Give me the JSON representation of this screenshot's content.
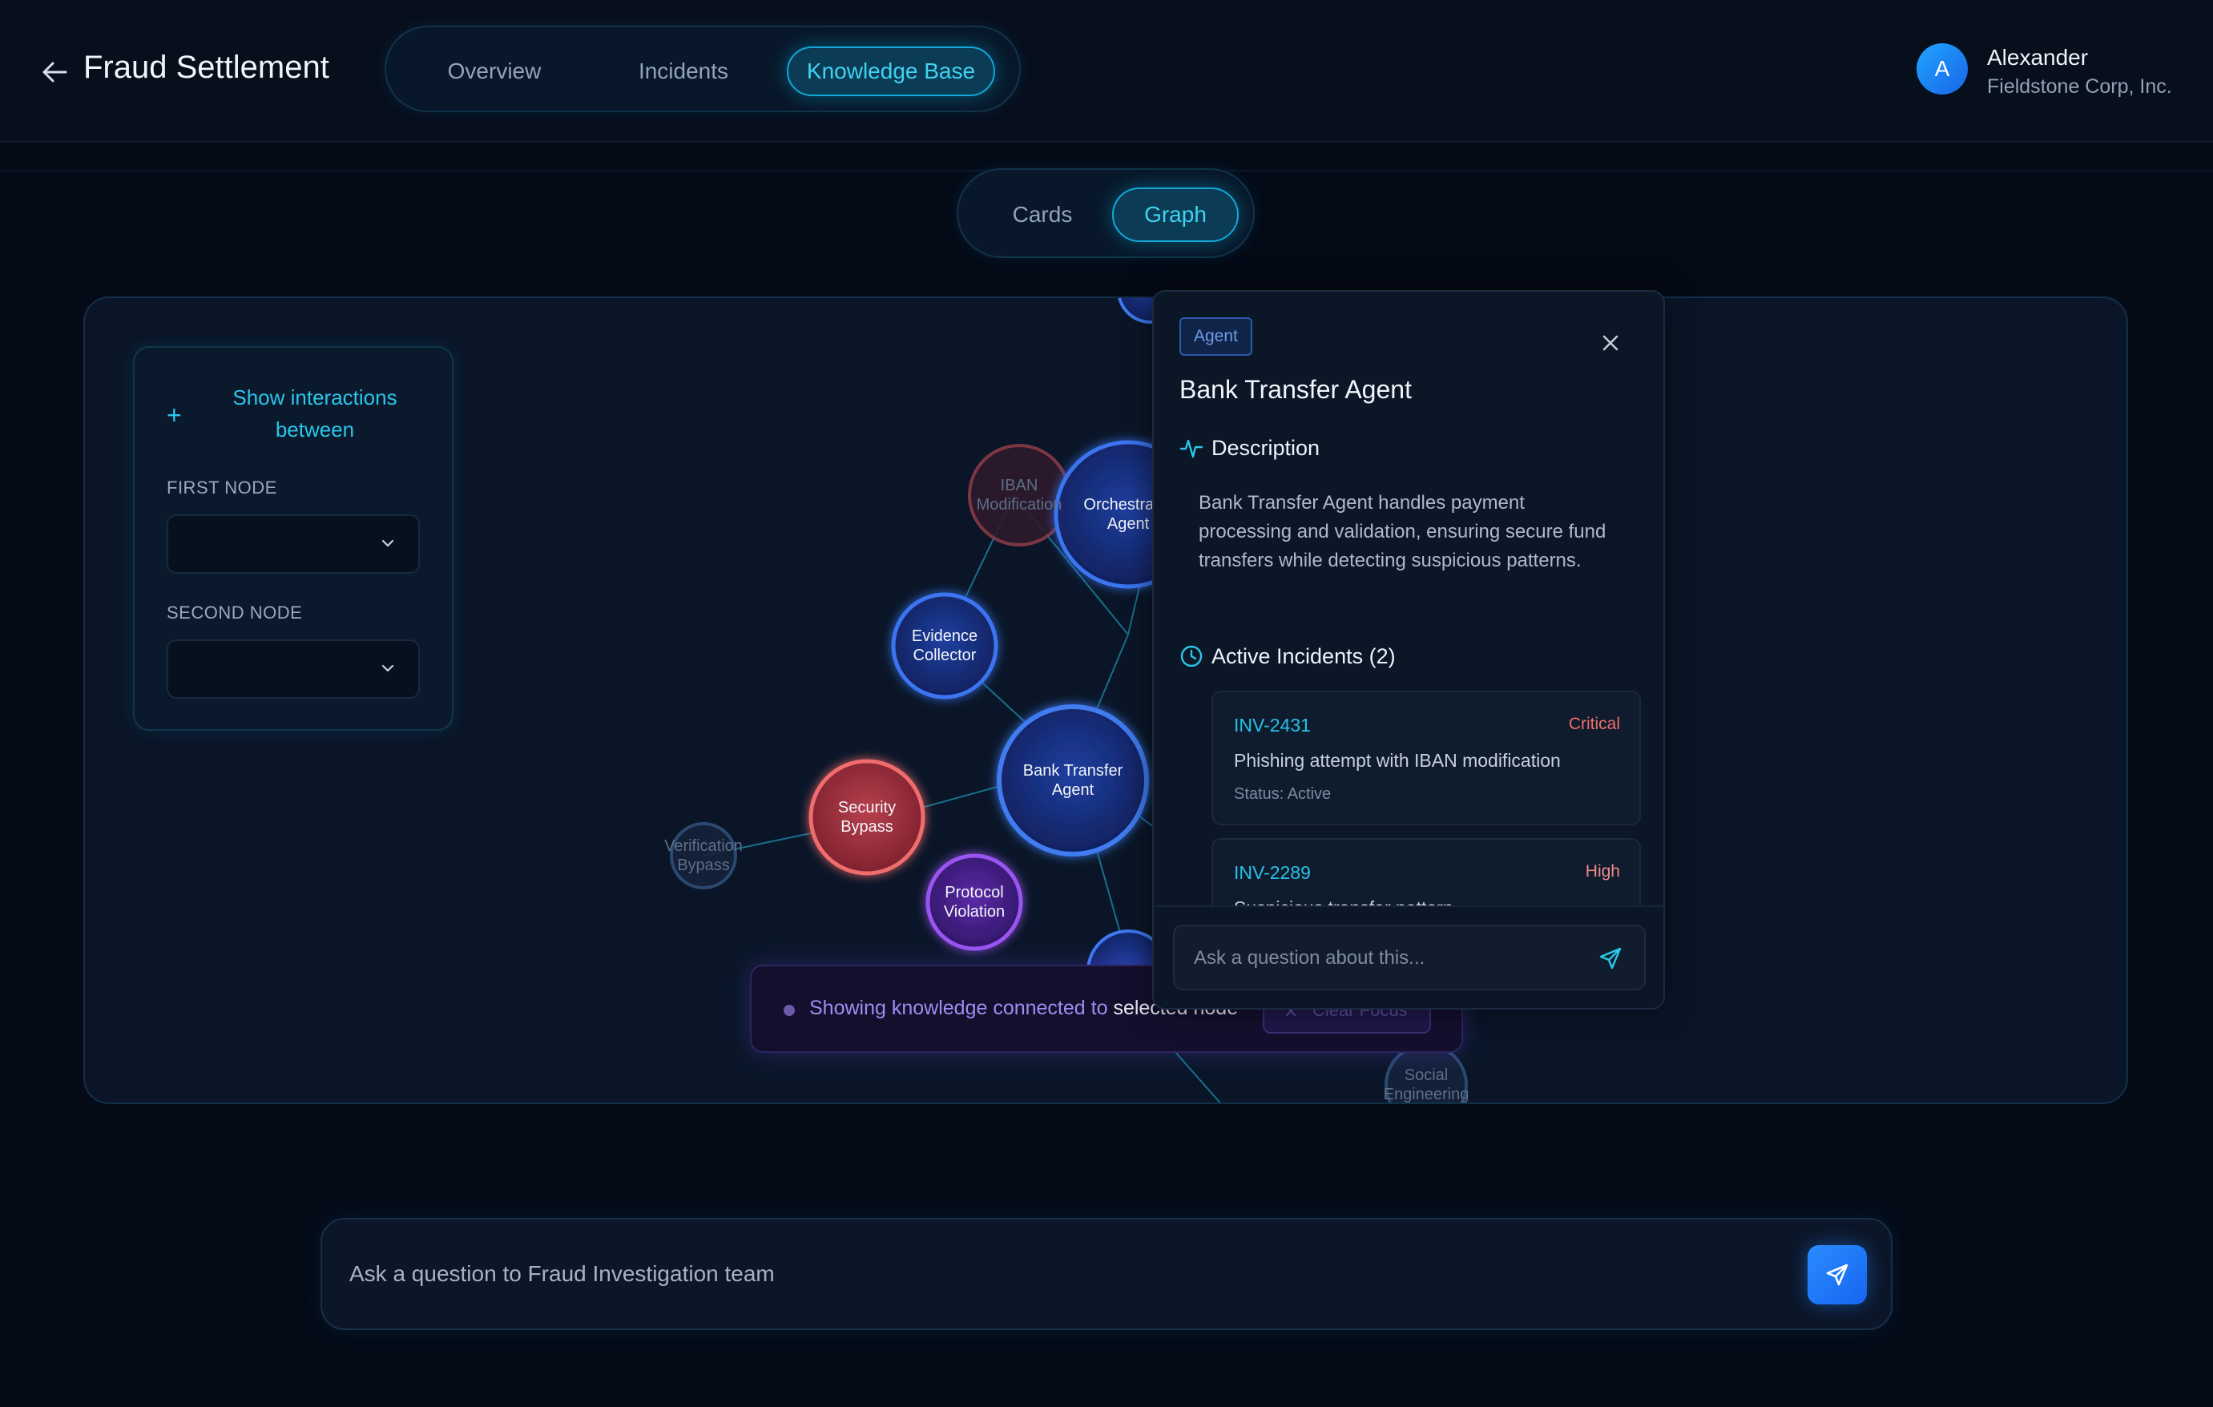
{
  "header": {
    "title": "Fraud Settlement",
    "tabs": [
      {
        "label": "Overview"
      },
      {
        "label": "Incidents"
      },
      {
        "label": "Knowledge Base"
      }
    ],
    "active_tab": "Knowledge Base",
    "user": {
      "initial": "A",
      "name": "Alexander",
      "org": "Fieldstone Corp, Inc."
    }
  },
  "view_toggle": {
    "options": [
      "Cards",
      "Graph"
    ],
    "active": "Graph"
  },
  "interactions_panel": {
    "title": "Show interactions between",
    "first_label": "FIRST NODE",
    "second_label": "SECOND NODE"
  },
  "graph": {
    "nodes": [
      {
        "id": "iban",
        "label": "IBAN Modification",
        "style": "red-dim"
      },
      {
        "id": "orch",
        "label": "Orchestrator Agent",
        "style": "blue"
      },
      {
        "id": "evidence",
        "label": "Evidence Collector",
        "style": "blue"
      },
      {
        "id": "bank",
        "label": "Bank Transfer Agent",
        "style": "blue-selected"
      },
      {
        "id": "security",
        "label": "Security Bypass",
        "style": "red"
      },
      {
        "id": "verification",
        "label": "Verification Bypass",
        "style": "dim"
      },
      {
        "id": "protocol",
        "label": "Protocol Violation",
        "style": "purple"
      },
      {
        "id": "social",
        "label": "Social Engineering",
        "style": "dim"
      }
    ]
  },
  "focus_banner": {
    "text_prefix": "Showing knowledge connected to ",
    "text_suffix": "selected node",
    "clear_label": "Clear Focus"
  },
  "detail": {
    "badge": "Agent",
    "title": "Bank Transfer Agent",
    "description_title": "Description",
    "description": "Bank Transfer Agent handles payment processing and validation, ensuring secure fund transfers while detecting suspicious patterns.",
    "incidents_title": "Active Incidents (2)",
    "incidents": [
      {
        "id": "INV-2431",
        "severity": "Critical",
        "desc": "Phishing attempt with IBAN modification",
        "status": "Status: Active"
      },
      {
        "id": "INV-2289",
        "severity": "High",
        "desc": "Suspicious transfer pattern",
        "status": ""
      }
    ],
    "input_placeholder": "Ask a question about this..."
  },
  "chat": {
    "placeholder": "Ask a question to Fraud Investigation team"
  },
  "colors": {
    "accent": "#2bc6ea",
    "critical": "#f06d6d",
    "high": "#f08a8a",
    "background": "#040a16"
  }
}
